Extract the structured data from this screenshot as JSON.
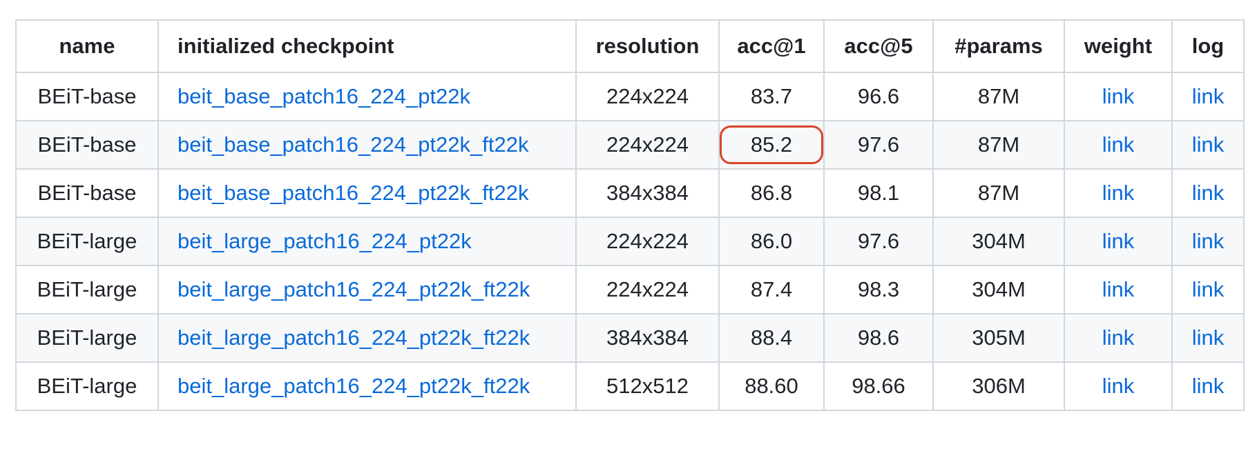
{
  "table": {
    "headers": [
      "name",
      "initialized checkpoint",
      "resolution",
      "acc@1",
      "acc@5",
      "#params",
      "weight",
      "log"
    ],
    "rows": [
      {
        "name": "BEiT-base",
        "checkpoint": "beit_base_patch16_224_pt22k",
        "resolution": "224x224",
        "acc1": "83.7",
        "acc5": "96.6",
        "params": "87M",
        "weight": "link",
        "log": "link"
      },
      {
        "name": "BEiT-base",
        "checkpoint": "beit_base_patch16_224_pt22k_ft22k",
        "resolution": "224x224",
        "acc1": "85.2",
        "acc5": "97.6",
        "params": "87M",
        "weight": "link",
        "log": "link"
      },
      {
        "name": "BEiT-base",
        "checkpoint": "beit_base_patch16_224_pt22k_ft22k",
        "resolution": "384x384",
        "acc1": "86.8",
        "acc5": "98.1",
        "params": "87M",
        "weight": "link",
        "log": "link"
      },
      {
        "name": "BEiT-large",
        "checkpoint": "beit_large_patch16_224_pt22k",
        "resolution": "224x224",
        "acc1": "86.0",
        "acc5": "97.6",
        "params": "304M",
        "weight": "link",
        "log": "link"
      },
      {
        "name": "BEiT-large",
        "checkpoint": "beit_large_patch16_224_pt22k_ft22k",
        "resolution": "224x224",
        "acc1": "87.4",
        "acc5": "98.3",
        "params": "304M",
        "weight": "link",
        "log": "link"
      },
      {
        "name": "BEiT-large",
        "checkpoint": "beit_large_patch16_224_pt22k_ft22k",
        "resolution": "384x384",
        "acc1": "88.4",
        "acc5": "98.6",
        "params": "305M",
        "weight": "link",
        "log": "link"
      },
      {
        "name": "BEiT-large",
        "checkpoint": "beit_large_patch16_224_pt22k_ft22k",
        "resolution": "512x512",
        "acc1": "88.60",
        "acc5": "98.66",
        "params": "306M",
        "weight": "link",
        "log": "link"
      }
    ]
  },
  "colors": {
    "link": "#0969da",
    "border": "#d0d7de",
    "stripe": "#f6f8fa",
    "highlight": "#d9442b"
  }
}
